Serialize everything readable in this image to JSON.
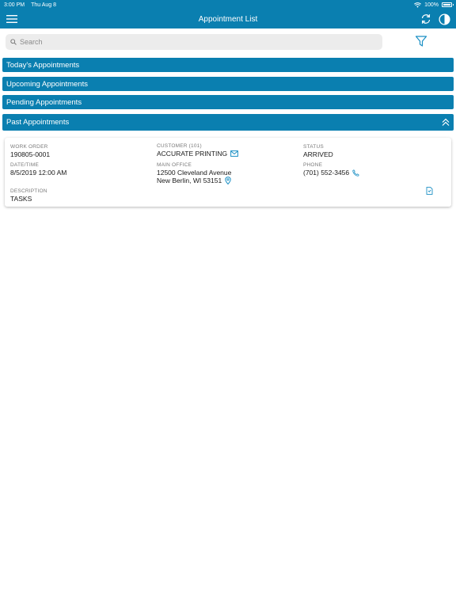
{
  "status_bar": {
    "time": "3:00 PM",
    "date": "Thu Aug 8",
    "battery": "100%"
  },
  "navbar": {
    "title": "Appointment List",
    "menu_icon": "hamburger-menu-icon",
    "refresh_icon": "refresh-icon",
    "contrast_icon": "contrast-icon"
  },
  "search": {
    "placeholder": "Search",
    "value": ""
  },
  "sections": {
    "today": "Today's Appointments",
    "upcoming": "Upcoming Appointments",
    "pending": "Pending Appointments",
    "past": "Past Appointments"
  },
  "appointment": {
    "work_order_label": "WORK ORDER",
    "work_order": "190805-0001",
    "datetime_label": "DATE/TIME",
    "datetime": "8/5/2019 12:00 AM",
    "description_label": "DESCRIPTION",
    "description": "TASKS",
    "customer_label": "CUSTOMER (101)",
    "customer": "ACCURATE PRINTING",
    "office_label": "MAIN OFFICE",
    "address_line1": "12500 Cleveland Avenue",
    "address_line2": "New Berlin, WI 53151",
    "status_label": "STATUS",
    "status": "ARRIVED",
    "phone_label": "PHONE",
    "phone": "(701) 552-3456"
  },
  "colors": {
    "accent": "#0a7fb0",
    "icon_blue": "#1a8fc4",
    "label_gray": "#7a7a7a"
  }
}
